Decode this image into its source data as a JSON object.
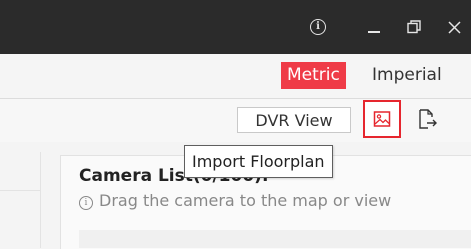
{
  "titlebar": {
    "info_icon": "info-icon",
    "minimize_icon": "minimize-icon",
    "restore_icon": "restore-icon",
    "close_icon": "close-icon",
    "background": "#2b2b2b"
  },
  "units": {
    "metric_label": "Metric",
    "imperial_label": "Imperial",
    "selected": "Metric",
    "accent": "#ef3b47"
  },
  "toolbar": {
    "dvr_view_label": "DVR View",
    "import_floorplan_icon": "image-import-icon",
    "export_icon": "export-icon",
    "highlight_color": "#e6262e"
  },
  "tooltip": {
    "text": "Import Floorplan"
  },
  "camera_panel": {
    "title": "Camera List(0/100):",
    "hint": "Drag the camera to the map or view"
  }
}
